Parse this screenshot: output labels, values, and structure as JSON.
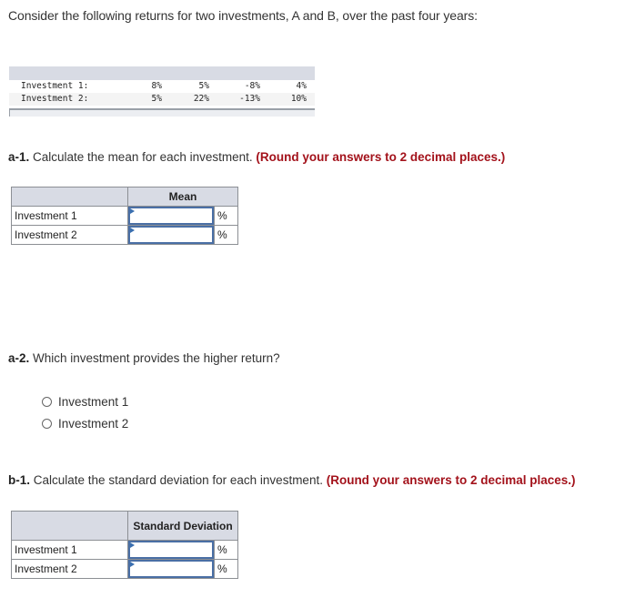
{
  "intro": "Consider the following returns for two investments, A and B, over the past four years:",
  "returns_table": {
    "rows": [
      {
        "label": "Investment 1:",
        "values": [
          "8%",
          "5%",
          "-8%",
          "4%"
        ]
      },
      {
        "label": "Investment 2:",
        "values": [
          "5%",
          "22%",
          "-13%",
          "10%"
        ]
      }
    ]
  },
  "a1": {
    "number": "a-1.",
    "text": " Calculate the mean for each investment. ",
    "hint": "(Round your answers to 2 decimal places.)",
    "table": {
      "header": "Mean",
      "rows": [
        {
          "label": "Investment 1",
          "value": "",
          "unit": "%"
        },
        {
          "label": "Investment 2",
          "value": "",
          "unit": "%"
        }
      ]
    }
  },
  "a2": {
    "number": "a-2.",
    "text": " Which investment provides the higher return?",
    "options": [
      "Investment 1",
      "Investment 2"
    ]
  },
  "b1": {
    "number": "b-1.",
    "text": " Calculate the standard deviation for each investment. ",
    "hint": "(Round your answers to 2 decimal places.)",
    "table": {
      "header": "Standard Deviation",
      "rows": [
        {
          "label": "Investment 1",
          "value": "",
          "unit": "%"
        },
        {
          "label": "Investment 2",
          "value": "",
          "unit": "%"
        }
      ]
    }
  }
}
